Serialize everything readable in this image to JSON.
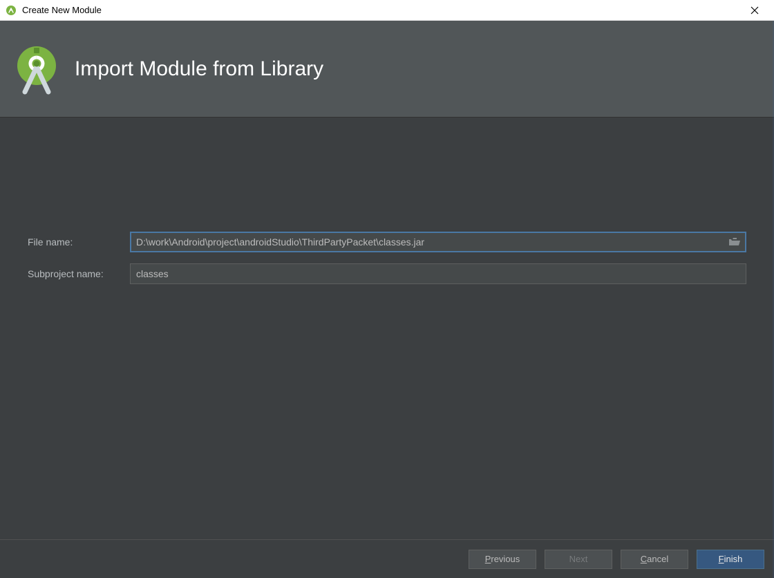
{
  "window": {
    "title": "Create New Module"
  },
  "banner": {
    "heading": "Import Module from Library"
  },
  "form": {
    "filename_label": "File name:",
    "filename_value": "D:\\work\\Android\\project\\androidStudio\\ThirdPartyPacket\\classes.jar",
    "subproject_label": "Subproject name:",
    "subproject_value": "classes"
  },
  "buttons": {
    "previous_prefix": "P",
    "previous_rest": "revious",
    "next": "Next",
    "cancel_prefix": "C",
    "cancel_rest": "ancel",
    "finish_prefix": "F",
    "finish_rest": "inish"
  },
  "icons": {
    "app": "android-studio-icon",
    "close": "close-icon",
    "logo": "android-studio-logo",
    "browse": "folder-open-icon"
  }
}
